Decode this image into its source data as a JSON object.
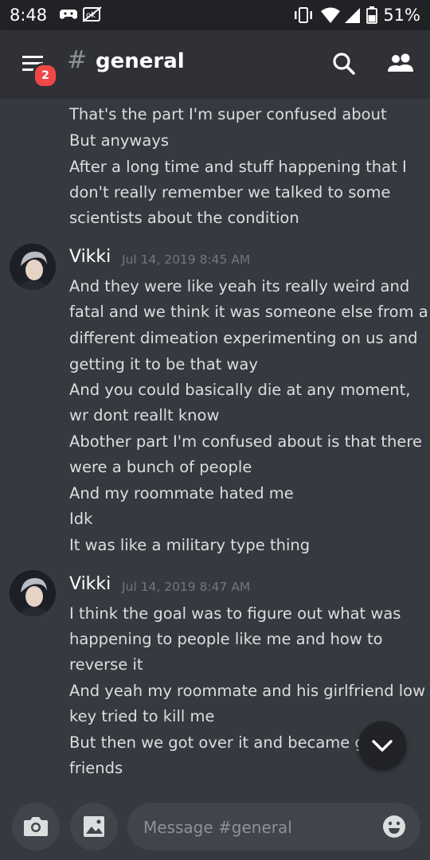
{
  "status_bar": {
    "time": "8:48",
    "battery": "51%",
    "left_icons": [
      "gamepad-icon",
      "no-sim-icon"
    ],
    "right_icons": [
      "vibrate-icon",
      "wifi-icon",
      "signal-icon",
      "battery-icon"
    ]
  },
  "header": {
    "hash": "#",
    "channel_name": "general",
    "unread_badge": "2"
  },
  "messages": {
    "partial_top_lines": [
      "That's the part I'm super confused about",
      "But anyways",
      "After a long time and stuff happening that I",
      "don't really remember we talked to some",
      "scientists about the condition"
    ],
    "groups": [
      {
        "author": "Vikki",
        "timestamp": "Jul 14, 2019 8:45 AM",
        "lines": [
          "And they were like yeah its really weird and",
          "fatal and we think it was someone else from a",
          "different dimeation experimenting on us and",
          "getting it to be that way",
          "And you could basically die at any moment,",
          "wr dont reallt know",
          "Abother part I'm confused about is that there",
          "were a bunch of people",
          "And my roommate hated me",
          "Idk",
          "It was like a military type thing"
        ]
      },
      {
        "author": "Vikki",
        "timestamp": "Jul 14, 2019 8:47 AM",
        "lines": [
          "I think the goal was to figure out what was",
          "happening to people like me and how to",
          "reverse it",
          "And yeah my roommate and his girlfriend low",
          "key tried to kill me",
          "But then we got over it and became gre",
          "friends"
        ]
      }
    ]
  },
  "composer": {
    "placeholder": "Message #general"
  },
  "colors": {
    "background": "#36393f",
    "header": "#2f3136",
    "status_bar": "#202225",
    "badge": "#f04747",
    "text": "#dcddde",
    "muted": "#72767d"
  }
}
